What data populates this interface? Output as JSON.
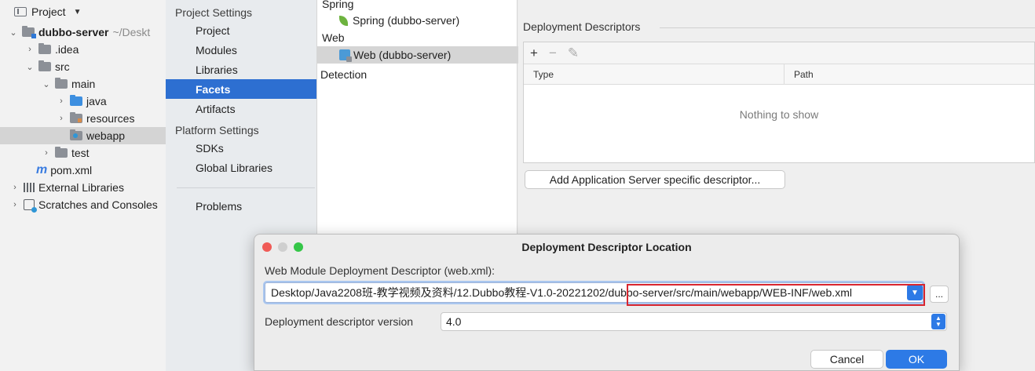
{
  "project_panel": {
    "title": "Project",
    "tree": [
      {
        "label": "dubbo-server",
        "extra": "~/Deskt"
      },
      {
        "label": ".idea"
      },
      {
        "label": "src"
      },
      {
        "label": "main"
      },
      {
        "label": "java"
      },
      {
        "label": "resources"
      },
      {
        "label": "webapp"
      },
      {
        "label": "test"
      },
      {
        "label": "pom.xml"
      },
      {
        "label": "External Libraries"
      },
      {
        "label": "Scratches and Consoles"
      }
    ]
  },
  "structure_nav": {
    "project_settings": "Project Settings",
    "project": "Project",
    "modules": "Modules",
    "libraries": "Libraries",
    "facets": "Facets",
    "artifacts": "Artifacts",
    "platform_settings": "Platform Settings",
    "sdks": "SDKs",
    "global_libraries": "Global Libraries",
    "problems": "Problems"
  },
  "facets_list": {
    "spring_group": "Spring",
    "spring_item": "Spring (dubbo-server)",
    "web_group": "Web",
    "web_item": "Web (dubbo-server)",
    "detection": "Detection"
  },
  "descriptors": {
    "title": "Deployment Descriptors",
    "col_type": "Type",
    "col_path": "Path",
    "empty_text": "Nothing to show",
    "add_server_button": "Add Application Server specific descriptor...",
    "add_icon": "+",
    "remove_icon": "−",
    "edit_icon": "✎"
  },
  "dialog": {
    "title": "Deployment Descriptor Location",
    "field_label": "Web Module Deployment Descriptor (web.xml):",
    "path_value": "Desktop/Java2208班-教学视频及资料/12.Dubbo教程-V1.0-20221202/dubbo-server/src/main/webapp/WEB-INF/web.xml",
    "browse_label": "...",
    "version_label": "Deployment descriptor version",
    "version_value": "4.0",
    "cancel_label": "Cancel",
    "ok_label": "OK"
  }
}
